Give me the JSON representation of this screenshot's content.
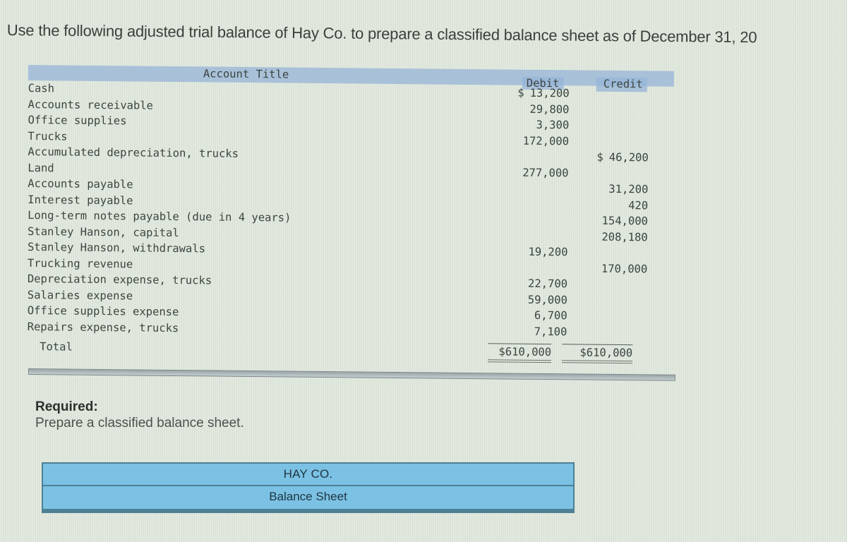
{
  "instruction": "Use the following adjusted trial balance of Hay Co. to prepare a classified balance sheet as of December 31, 20",
  "trial_balance": {
    "headers": {
      "account": "Account Title",
      "debit": "Debit",
      "credit": "Credit"
    },
    "rows": [
      {
        "account": "Cash",
        "debit": "13,200",
        "debit_prefix": "$",
        "credit": ""
      },
      {
        "account": "Accounts receivable",
        "debit": "29,800",
        "credit": ""
      },
      {
        "account": "Office supplies",
        "debit": "3,300",
        "credit": ""
      },
      {
        "account": "Trucks",
        "debit": "172,000",
        "credit": ""
      },
      {
        "account": "Accumulated depreciation, trucks",
        "debit": "",
        "credit": "46,200",
        "credit_prefix": "$"
      },
      {
        "account": "Land",
        "debit": "277,000",
        "credit": ""
      },
      {
        "account": "Accounts payable",
        "debit": "",
        "credit": "31,200"
      },
      {
        "account": "Interest payable",
        "debit": "",
        "credit": "420"
      },
      {
        "account": "Long-term notes payable (due in 4 years)",
        "debit": "",
        "credit": "154,000"
      },
      {
        "account": "Stanley Hanson, capital",
        "debit": "",
        "credit": "208,180"
      },
      {
        "account": "Stanley Hanson, withdrawals",
        "debit": "19,200",
        "credit": ""
      },
      {
        "account": "Trucking revenue",
        "debit": "",
        "credit": "170,000"
      },
      {
        "account": "Depreciation expense, trucks",
        "debit": "22,700",
        "credit": ""
      },
      {
        "account": "Salaries expense",
        "debit": "59,000",
        "credit": ""
      },
      {
        "account": "Office supplies expense",
        "debit": "6,700",
        "credit": ""
      },
      {
        "account": "Repairs expense, trucks",
        "debit": "7,100",
        "credit": ""
      }
    ],
    "total": {
      "label": "Total",
      "debit": "$610,000",
      "credit": "$610,000"
    }
  },
  "required": {
    "label": "Required:",
    "text": "Prepare a classified balance sheet."
  },
  "balance_sheet": {
    "company": "HAY CO.",
    "title": "Balance Sheet"
  }
}
